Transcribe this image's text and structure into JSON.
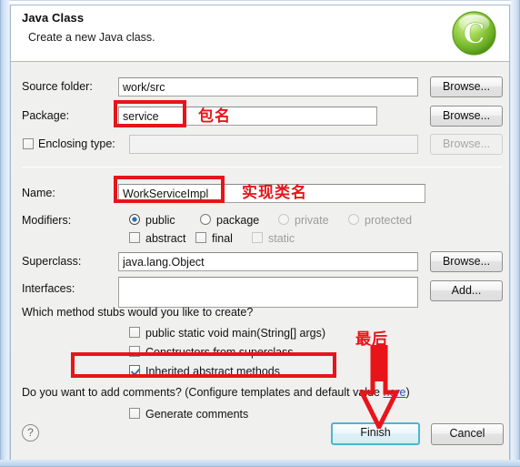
{
  "dialog": {
    "title": "Java Class",
    "subtitle": "Create a new Java class.",
    "icon": "java-class-wizard-icon"
  },
  "form": {
    "source_folder": {
      "label": "Source folder:",
      "value": "work/src",
      "browse_label": "Browse..."
    },
    "package": {
      "label": "Package:",
      "value": "service",
      "browse_label": "Browse..."
    },
    "enclosing_type": {
      "label": "Enclosing type:",
      "value": "",
      "checked": false,
      "browse_label": "Browse..."
    },
    "name": {
      "label": "Name:",
      "value": "WorkServiceImpl"
    },
    "modifiers": {
      "label": "Modifiers:",
      "access": [
        {
          "label": "public",
          "checked": true,
          "disabled": false
        },
        {
          "label": "package",
          "checked": false,
          "disabled": false
        },
        {
          "label": "private",
          "checked": false,
          "disabled": true
        },
        {
          "label": "protected",
          "checked": false,
          "disabled": true
        }
      ],
      "flags": [
        {
          "label": "abstract",
          "checked": false,
          "disabled": false
        },
        {
          "label": "final",
          "checked": false,
          "disabled": false
        },
        {
          "label": "static",
          "checked": false,
          "disabled": true
        }
      ]
    },
    "superclass": {
      "label": "Superclass:",
      "value": "java.lang.Object",
      "browse_label": "Browse..."
    },
    "interfaces": {
      "label": "Interfaces:",
      "value": "",
      "add_label": "Add..."
    },
    "method_stubs": {
      "question": "Which method stubs would you like to create?",
      "options": [
        {
          "label": "public static void main(String[] args)",
          "checked": false
        },
        {
          "label": "Constructors from superclass",
          "checked": false
        },
        {
          "label": "Inherited abstract methods",
          "checked": true
        }
      ]
    },
    "comments": {
      "question_prefix": "Do you want to add comments? (Configure templates and default value ",
      "link_label": "here",
      "question_suffix": ")",
      "generate_label": "Generate comments",
      "generate_checked": false
    }
  },
  "footer": {
    "help_glyph": "?",
    "finish_label": "Finish",
    "cancel_label": "Cancel"
  },
  "annotations": {
    "package_note": "包名",
    "class_name_note": "实现类名",
    "finish_note": "最后",
    "color": "#e8141a"
  }
}
